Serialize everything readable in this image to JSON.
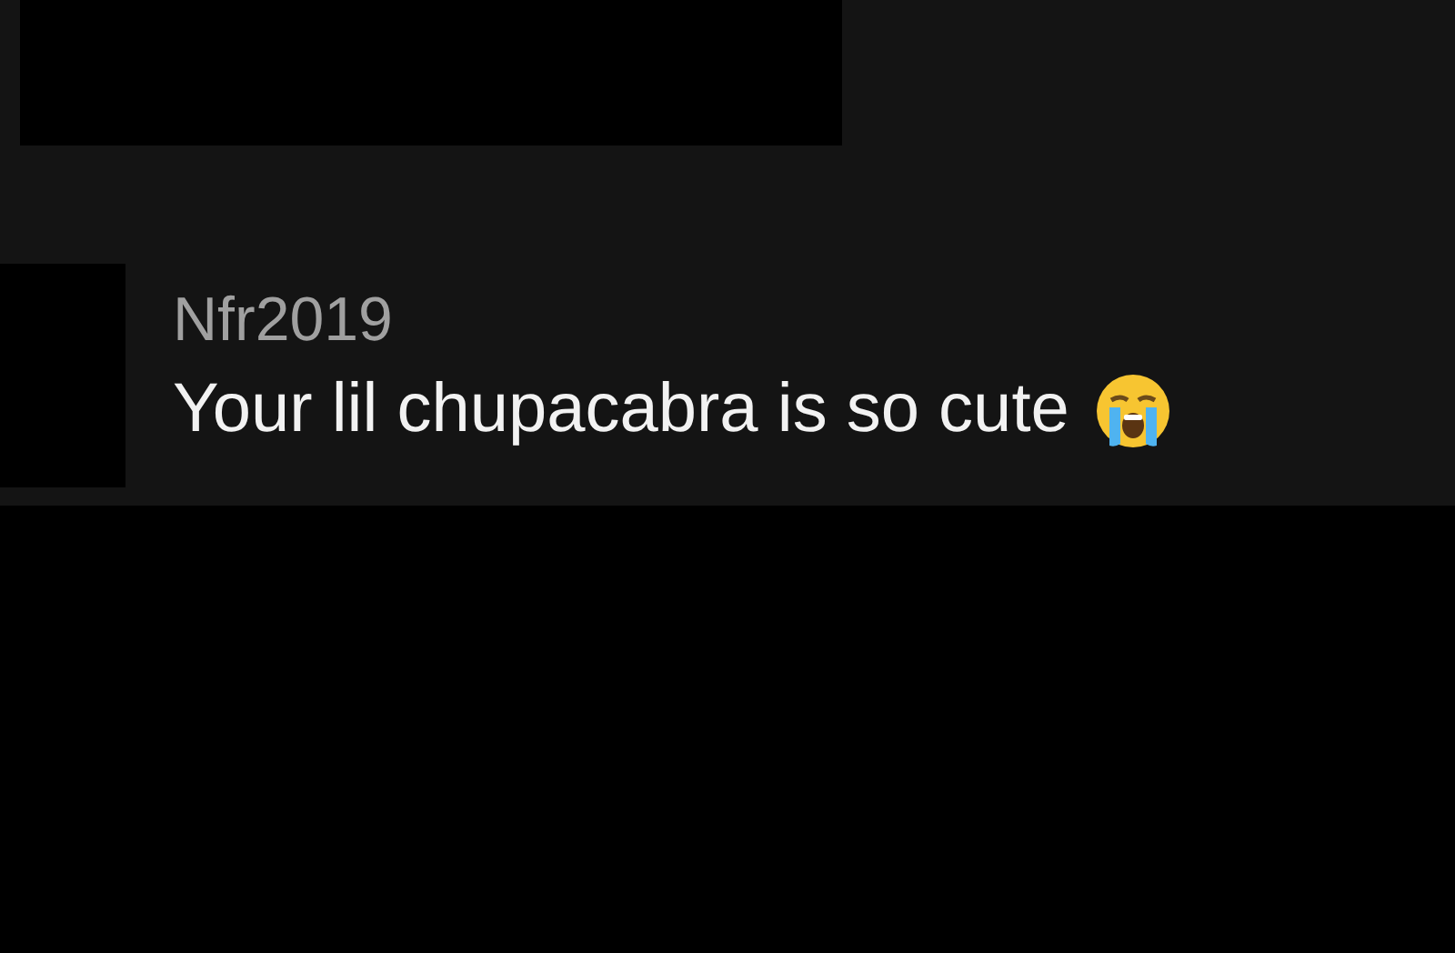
{
  "comment": {
    "username": "Nfr2019",
    "text": "Your lil chupacabra is so cute"
  }
}
